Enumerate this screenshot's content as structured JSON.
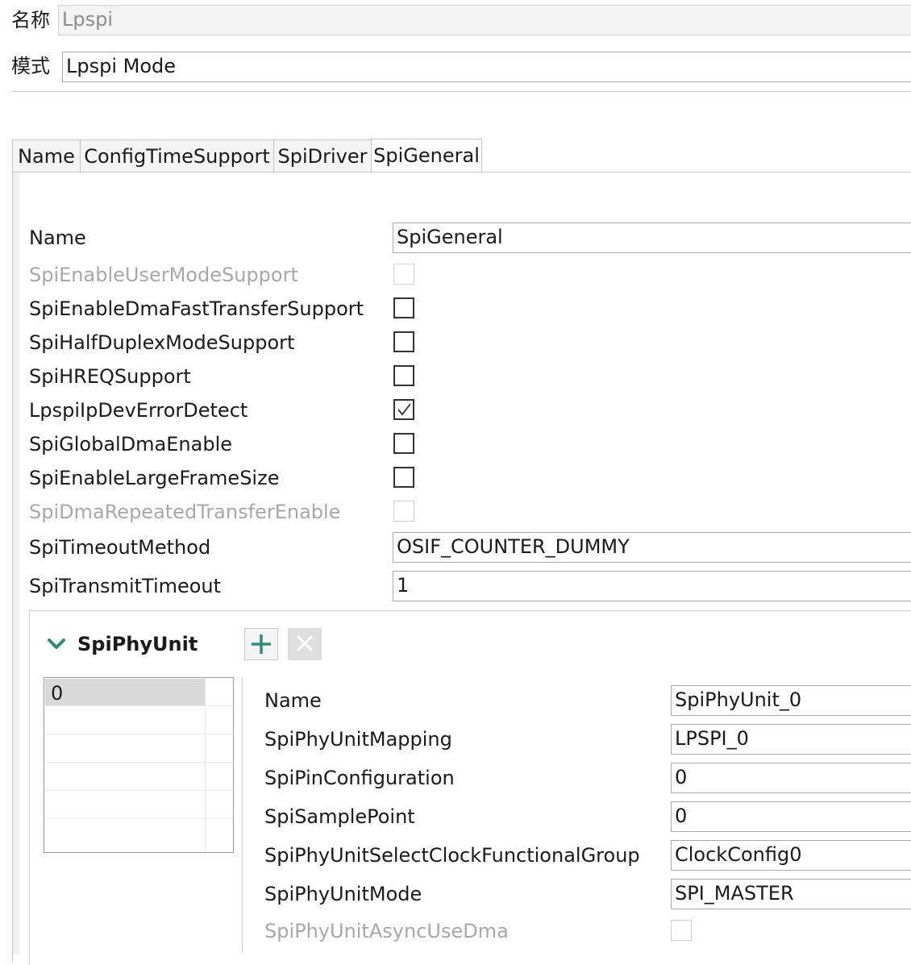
{
  "header": {
    "name_label": "名称",
    "name_value": "Lpspi",
    "mode_label": "模式",
    "mode_value": "Lpspi Mode"
  },
  "tabs": [
    {
      "label": "Name"
    },
    {
      "label": "ConfigTimeSupport"
    },
    {
      "label": "SpiDriver"
    },
    {
      "label": "SpiGeneral"
    }
  ],
  "general": {
    "name_label": "Name",
    "name_value": "SpiGeneral",
    "options": [
      {
        "label": "SpiEnableUserModeSupport",
        "checked": false,
        "enabled": false
      },
      {
        "label": "SpiEnableDmaFastTransferSupport",
        "checked": false,
        "enabled": true
      },
      {
        "label": "SpiHalfDuplexModeSupport",
        "checked": false,
        "enabled": true
      },
      {
        "label": "SpiHREQSupport",
        "checked": false,
        "enabled": true
      },
      {
        "label": "LpspiIpDevErrorDetect",
        "checked": true,
        "enabled": true
      },
      {
        "label": "SpiGlobalDmaEnable",
        "checked": false,
        "enabled": true
      },
      {
        "label": "SpiEnableLargeFrameSize",
        "checked": false,
        "enabled": true
      },
      {
        "label": "SpiDmaRepeatedTransferEnable",
        "checked": false,
        "enabled": false
      }
    ],
    "timeout_method_label": "SpiTimeoutMethod",
    "timeout_method_value": "OSIF_COUNTER_DUMMY",
    "transmit_timeout_label": "SpiTransmitTimeout",
    "transmit_timeout_value": "1"
  },
  "phy_unit": {
    "title": "SpiPhyUnit",
    "list_items": [
      "0"
    ],
    "fields": [
      {
        "label": "Name",
        "value": "SpiPhyUnit_0"
      },
      {
        "label": "SpiPhyUnitMapping",
        "value": "LPSPI_0"
      },
      {
        "label": "SpiPinConfiguration",
        "value": "0"
      },
      {
        "label": "SpiSamplePoint",
        "value": "0"
      },
      {
        "label": "SpiPhyUnitSelectClockFunctionalGroup",
        "value": "ClockConfig0"
      },
      {
        "label": "SpiPhyUnitMode",
        "value": "SPI_MASTER"
      }
    ],
    "async_dma_label": "SpiPhyUnitAsyncUseDma",
    "async_dma_checked": false
  },
  "colors": {
    "accent_teal": "#2e8b74",
    "disabled_text": "#a8a8a8"
  }
}
